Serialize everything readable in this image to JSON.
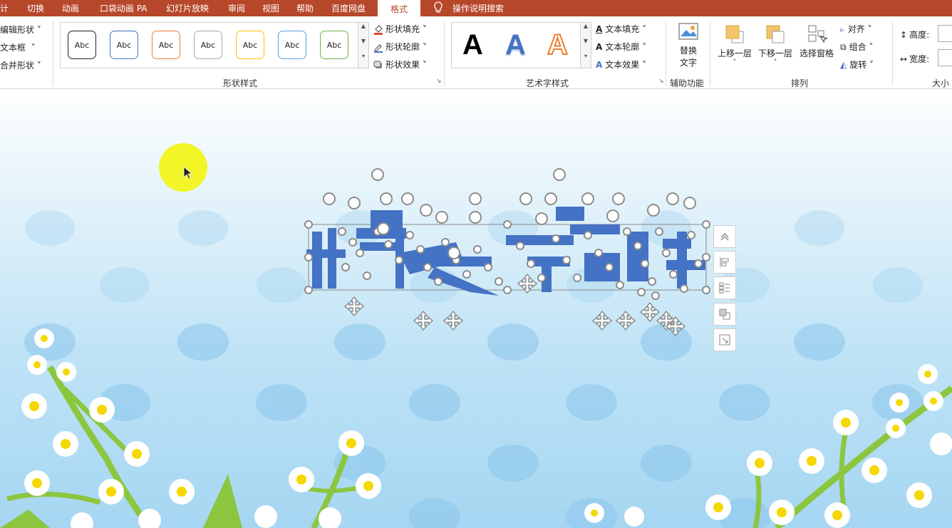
{
  "menu": {
    "tabs": [
      "计",
      "切换",
      "动画",
      "口袋动画 PA",
      "幻灯片放映",
      "审阅",
      "视图",
      "帮助",
      "百度网盘"
    ],
    "active_tab": "格式",
    "search_label": "操作说明搜索"
  },
  "ribbon": {
    "insert_shapes": {
      "items": [
        "编辑形状",
        "文本框",
        "合并形状"
      ]
    },
    "shape_styles": {
      "label": "形状样式",
      "sample_text": "Abc",
      "sample_colors": [
        "#222222",
        "#4472c4",
        "#ed7d31",
        "#a5a5a5",
        "#ffc000",
        "#5b9bd5",
        "#70ad47"
      ],
      "fill": "形状填充",
      "outline": "形状轮廓",
      "effects": "形状效果"
    },
    "wordart": {
      "label": "艺术字样式",
      "letter": "A",
      "text_fill": "文本填充",
      "text_outline": "文本轮廓",
      "text_effects": "文本效果"
    },
    "accessibility": {
      "label": "辅助功能",
      "alt_text_line1": "替换",
      "alt_text_line2": "文字"
    },
    "arrange": {
      "label": "排列",
      "bring_forward": "上移一层",
      "send_backward": "下移一层",
      "selection_pane": "选择窗格",
      "align": "对齐",
      "group": "组合",
      "rotate": "旋转"
    },
    "size": {
      "label": "大小",
      "height": "高度:",
      "width": "宽度:"
    }
  },
  "colors": {
    "menubar": "#b7472a",
    "wordart_blue": "#4472c4",
    "selection_handle": "#8c8c8c",
    "cursor_highlight": "#f5f500"
  }
}
